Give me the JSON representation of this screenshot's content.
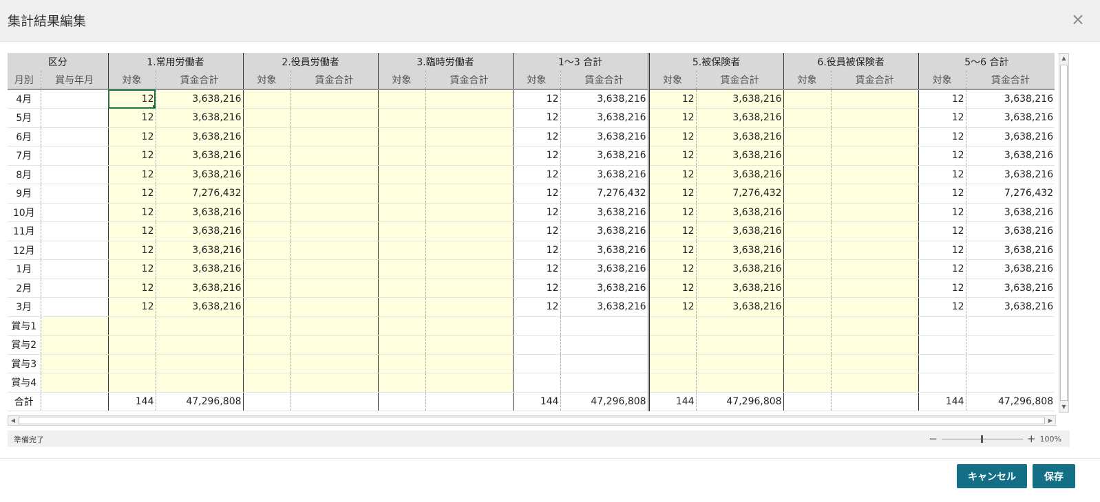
{
  "dialog": {
    "title": "集計結果編集",
    "close_symbol": "×"
  },
  "header": {
    "groups": [
      "区分",
      "1.常用労働者",
      "2.役員労働者",
      "3.臨時労働者",
      "1～3 合計",
      "5.被保険者",
      "6.役員被保険者",
      "5～6 合計"
    ],
    "kubun_sub": [
      "月別",
      "賞与年月"
    ],
    "sub_target": "対象",
    "sub_wage": "賃金合計"
  },
  "rows": [
    {
      "label": "4月",
      "c1": [
        "12",
        "3,638,216"
      ],
      "c2": [
        "",
        ""
      ],
      "c3": [
        "",
        ""
      ],
      "c13": [
        "12",
        "3,638,216"
      ],
      "c5": [
        "12",
        "3,638,216"
      ],
      "c6": [
        "",
        ""
      ],
      "c56": [
        "12",
        "3,638,216"
      ]
    },
    {
      "label": "5月",
      "c1": [
        "12",
        "3,638,216"
      ],
      "c2": [
        "",
        ""
      ],
      "c3": [
        "",
        ""
      ],
      "c13": [
        "12",
        "3,638,216"
      ],
      "c5": [
        "12",
        "3,638,216"
      ],
      "c6": [
        "",
        ""
      ],
      "c56": [
        "12",
        "3,638,216"
      ]
    },
    {
      "label": "6月",
      "c1": [
        "12",
        "3,638,216"
      ],
      "c2": [
        "",
        ""
      ],
      "c3": [
        "",
        ""
      ],
      "c13": [
        "12",
        "3,638,216"
      ],
      "c5": [
        "12",
        "3,638,216"
      ],
      "c6": [
        "",
        ""
      ],
      "c56": [
        "12",
        "3,638,216"
      ]
    },
    {
      "label": "7月",
      "c1": [
        "12",
        "3,638,216"
      ],
      "c2": [
        "",
        ""
      ],
      "c3": [
        "",
        ""
      ],
      "c13": [
        "12",
        "3,638,216"
      ],
      "c5": [
        "12",
        "3,638,216"
      ],
      "c6": [
        "",
        ""
      ],
      "c56": [
        "12",
        "3,638,216"
      ]
    },
    {
      "label": "8月",
      "c1": [
        "12",
        "3,638,216"
      ],
      "c2": [
        "",
        ""
      ],
      "c3": [
        "",
        ""
      ],
      "c13": [
        "12",
        "3,638,216"
      ],
      "c5": [
        "12",
        "3,638,216"
      ],
      "c6": [
        "",
        ""
      ],
      "c56": [
        "12",
        "3,638,216"
      ]
    },
    {
      "label": "9月",
      "c1": [
        "12",
        "7,276,432"
      ],
      "c2": [
        "",
        ""
      ],
      "c3": [
        "",
        ""
      ],
      "c13": [
        "12",
        "7,276,432"
      ],
      "c5": [
        "12",
        "7,276,432"
      ],
      "c6": [
        "",
        ""
      ],
      "c56": [
        "12",
        "7,276,432"
      ]
    },
    {
      "label": "10月",
      "c1": [
        "12",
        "3,638,216"
      ],
      "c2": [
        "",
        ""
      ],
      "c3": [
        "",
        ""
      ],
      "c13": [
        "12",
        "3,638,216"
      ],
      "c5": [
        "12",
        "3,638,216"
      ],
      "c6": [
        "",
        ""
      ],
      "c56": [
        "12",
        "3,638,216"
      ]
    },
    {
      "label": "11月",
      "c1": [
        "12",
        "3,638,216"
      ],
      "c2": [
        "",
        ""
      ],
      "c3": [
        "",
        ""
      ],
      "c13": [
        "12",
        "3,638,216"
      ],
      "c5": [
        "12",
        "3,638,216"
      ],
      "c6": [
        "",
        ""
      ],
      "c56": [
        "12",
        "3,638,216"
      ]
    },
    {
      "label": "12月",
      "c1": [
        "12",
        "3,638,216"
      ],
      "c2": [
        "",
        ""
      ],
      "c3": [
        "",
        ""
      ],
      "c13": [
        "12",
        "3,638,216"
      ],
      "c5": [
        "12",
        "3,638,216"
      ],
      "c6": [
        "",
        ""
      ],
      "c56": [
        "12",
        "3,638,216"
      ]
    },
    {
      "label": "1月",
      "c1": [
        "12",
        "3,638,216"
      ],
      "c2": [
        "",
        ""
      ],
      "c3": [
        "",
        ""
      ],
      "c13": [
        "12",
        "3,638,216"
      ],
      "c5": [
        "12",
        "3,638,216"
      ],
      "c6": [
        "",
        ""
      ],
      "c56": [
        "12",
        "3,638,216"
      ]
    },
    {
      "label": "2月",
      "c1": [
        "12",
        "3,638,216"
      ],
      "c2": [
        "",
        ""
      ],
      "c3": [
        "",
        ""
      ],
      "c13": [
        "12",
        "3,638,216"
      ],
      "c5": [
        "12",
        "3,638,216"
      ],
      "c6": [
        "",
        ""
      ],
      "c56": [
        "12",
        "3,638,216"
      ]
    },
    {
      "label": "3月",
      "c1": [
        "12",
        "3,638,216"
      ],
      "c2": [
        "",
        ""
      ],
      "c3": [
        "",
        ""
      ],
      "c13": [
        "12",
        "3,638,216"
      ],
      "c5": [
        "12",
        "3,638,216"
      ],
      "c6": [
        "",
        ""
      ],
      "c56": [
        "12",
        "3,638,216"
      ]
    },
    {
      "label": "賞与1",
      "c1": [
        "",
        ""
      ],
      "c2": [
        "",
        ""
      ],
      "c3": [
        "",
        ""
      ],
      "c13": [
        "",
        ""
      ],
      "c5": [
        "",
        ""
      ],
      "c6": [
        "",
        ""
      ],
      "c56": [
        "",
        ""
      ]
    },
    {
      "label": "賞与2",
      "c1": [
        "",
        ""
      ],
      "c2": [
        "",
        ""
      ],
      "c3": [
        "",
        ""
      ],
      "c13": [
        "",
        ""
      ],
      "c5": [
        "",
        ""
      ],
      "c6": [
        "",
        ""
      ],
      "c56": [
        "",
        ""
      ]
    },
    {
      "label": "賞与3",
      "c1": [
        "",
        ""
      ],
      "c2": [
        "",
        ""
      ],
      "c3": [
        "",
        ""
      ],
      "c13": [
        "",
        ""
      ],
      "c5": [
        "",
        ""
      ],
      "c6": [
        "",
        ""
      ],
      "c56": [
        "",
        ""
      ]
    },
    {
      "label": "賞与4",
      "c1": [
        "",
        ""
      ],
      "c2": [
        "",
        ""
      ],
      "c3": [
        "",
        ""
      ],
      "c13": [
        "",
        ""
      ],
      "c5": [
        "",
        ""
      ],
      "c6": [
        "",
        ""
      ],
      "c56": [
        "",
        ""
      ]
    },
    {
      "label": "合計",
      "c1": [
        "144",
        "47,296,808"
      ],
      "c2": [
        "",
        ""
      ],
      "c3": [
        "",
        ""
      ],
      "c13": [
        "144",
        "47,296,808"
      ],
      "c5": [
        "144",
        "47,296,808"
      ],
      "c6": [
        "",
        ""
      ],
      "c56": [
        "144",
        "47,296,808"
      ]
    }
  ],
  "scroll": {
    "up": "▲",
    "down": "▼",
    "left": "◀",
    "right": "▶"
  },
  "statusbar": {
    "text": "準備完了",
    "zoom_minus": "−",
    "zoom_plus": "+",
    "zoom_level": "100%"
  },
  "buttons": {
    "cancel": "キャンセル",
    "save": "保存"
  },
  "colors": {
    "accent": "#136f85",
    "editable_cell": "#ffffe0",
    "header_bg": "#d8d8d8",
    "selection": "#217346"
  }
}
